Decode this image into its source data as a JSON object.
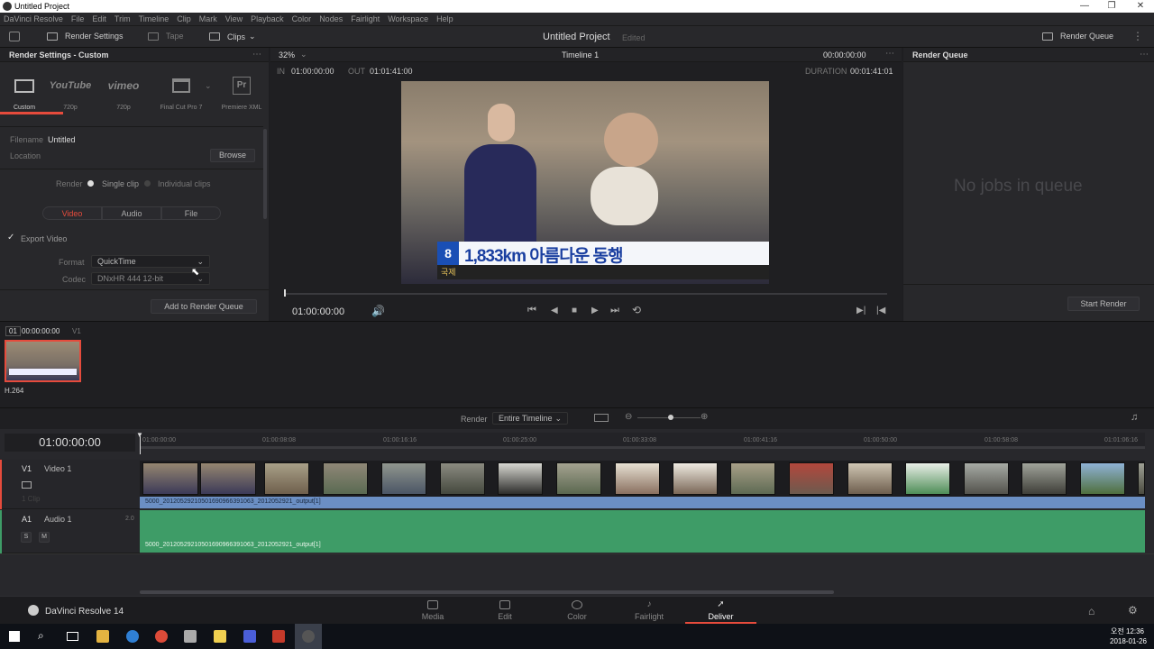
{
  "window": {
    "title": "Untitled Project",
    "controls": [
      "—",
      "❐",
      "✕"
    ]
  },
  "menu": [
    "DaVinci Resolve",
    "File",
    "Edit",
    "Trim",
    "Timeline",
    "Clip",
    "Mark",
    "View",
    "Playback",
    "Color",
    "Nodes",
    "Fairlight",
    "Workspace",
    "Help"
  ],
  "toolbar": {
    "render_settings": "Render Settings",
    "tape": "Tape",
    "clips": "Clips",
    "project_title": "Untitled Project",
    "edited": "Edited",
    "render_queue": "Render Queue"
  },
  "render_settings": {
    "header": "Render Settings - Custom",
    "presets": [
      {
        "name": "Custom",
        "sub": ""
      },
      {
        "name": "YouTube",
        "sub": "720p"
      },
      {
        "name": "vimeo",
        "sub": "720p"
      },
      {
        "name": "",
        "sub": "Final Cut Pro 7"
      },
      {
        "name": "Pr",
        "sub": "Premiere XML"
      }
    ],
    "preset_custom_label": "Custom",
    "filename_label": "Filename",
    "filename_value": "Untitled",
    "location_label": "Location",
    "browse": "Browse",
    "render_label": "Render",
    "single_clip": "Single clip",
    "individual_clips": "Individual clips",
    "tabs": [
      "Video",
      "Audio",
      "File"
    ],
    "export_video": "Export Video",
    "format_label": "Format",
    "format_value": "QuickTime",
    "codec_label": "Codec",
    "codec_value": "DNxHR 444 12-bit",
    "add_to_queue": "Add to Render Queue"
  },
  "viewer": {
    "zoom": "32%",
    "timeline_name": "Timeline 1",
    "timecode_top": "00:00:00:00",
    "in_label": "IN",
    "in_value": "01:00:00:00",
    "out_label": "OUT",
    "out_value": "01:01:41:00",
    "duration_label": "DURATION",
    "duration_value": "00:01:41:01",
    "caption": "1,833km 아름다운 동행",
    "caption_sub": "국제",
    "logo": "8",
    "current_tc": "01:00:00:00"
  },
  "render_queue": {
    "header": "Render Queue",
    "empty": "No jobs in queue",
    "start": "Start Render"
  },
  "clip_strip": {
    "index": "01",
    "tc": "00:00:00:00",
    "track": "V1",
    "codec": "H.264"
  },
  "timeline_bar": {
    "render_label": "Render",
    "render_value": "Entire Timeline"
  },
  "timeline": {
    "timecode": "01:00:00:00",
    "ruler": [
      "01:00:00:00",
      "01:00:08:08",
      "01:00:16:16",
      "01:00:25:00",
      "01:00:33:08",
      "01:00:41:16",
      "01:00:50:00",
      "01:00:58:08",
      "01:01:06:16"
    ],
    "v1_id": "V1",
    "v1_name": "Video 1",
    "v1_clips": "1 Clip",
    "a1_id": "A1",
    "a1_name": "Audio 1",
    "a1_level": "2.0",
    "solo": "S",
    "mute": "M",
    "clip_name": "5000_20120529210501690966391063_2012052921_output[1]"
  },
  "pages": [
    "Media",
    "Edit",
    "Color",
    "Fairlight",
    "Deliver"
  ],
  "active_page": "Deliver",
  "app_name": "DaVinci Resolve 14",
  "taskbar": {
    "time": "오전 12:36",
    "date": "2018-01-26"
  },
  "colors": {
    "accent": "#e64b3c",
    "audio": "#3e9c67",
    "video_bar": "#6b8fc4",
    "bg": "#1e1e21"
  }
}
